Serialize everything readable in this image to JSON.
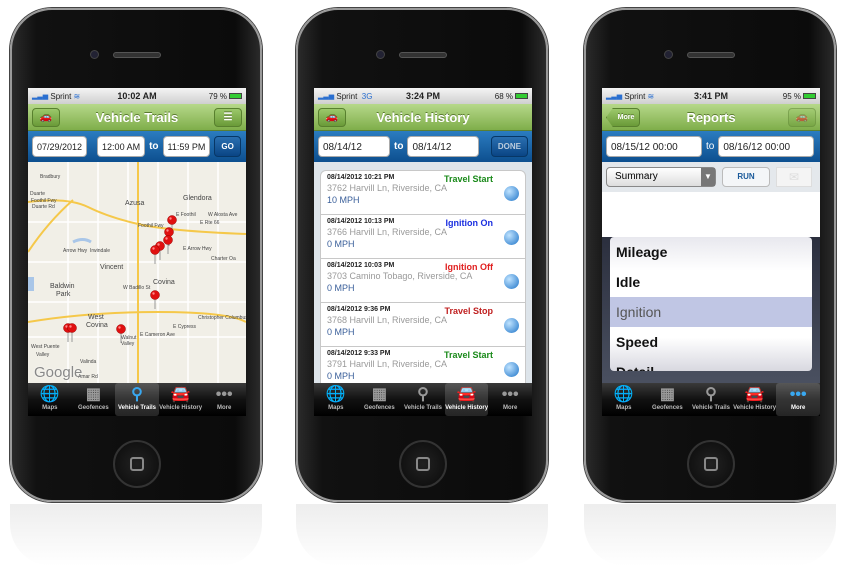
{
  "colors": {
    "nav_green": "#8dbb58",
    "date_blue": "#1a62a6",
    "travel_start": "#1a8a1a",
    "ignition_on": "#1a2ee0",
    "ignition_off": "#e02020",
    "travel_stop": "#c02020",
    "speed_text": "#3a5f9a"
  },
  "tabs": [
    {
      "label": "Maps",
      "icon": "globe-icon"
    },
    {
      "label": "Geofences",
      "icon": "grid-icon"
    },
    {
      "label": "Vehicle Trails",
      "icon": "joystick-pin-icon"
    },
    {
      "label": "Vehicle History",
      "icon": "car-clock-icon"
    },
    {
      "label": "More",
      "icon": "more-dots-icon"
    }
  ],
  "phone1": {
    "status": {
      "carrier": "Sprint",
      "time": "10:02 AM",
      "battery": "79 %"
    },
    "title": "Vehicle Trails",
    "active_tab": 2,
    "date": "07/29/2012",
    "from_time": "12:00 AM",
    "to": "to",
    "to_time": "11:59 PM",
    "go": "GO",
    "map_labels": [
      "Bradbury",
      "Duarte",
      "Foothil Fwy",
      "Duarte Rd",
      "Azusa",
      "Glendora",
      "E Foothil",
      "W Alosta Ave",
      "E Rte 66",
      "Foothil Fwy",
      "E Arrow Hwy",
      "Arrow Hwy",
      "Irwindale",
      "Charter Oa",
      "Vincent",
      "Baldwin",
      "Park",
      "Covina",
      "W Badillo St",
      "West",
      "Covina",
      "E Cypress",
      "E Cameron Ave",
      "Walnut",
      "Valley",
      "West Puente",
      "Valley",
      "Valinda",
      "Amar Rd",
      "Christopher Columbus Tr"
    ],
    "map_attribution": "Google"
  },
  "phone2": {
    "status": {
      "carrier": "Sprint",
      "network": "3G",
      "time": "3:24 PM",
      "battery": "68 %"
    },
    "title": "Vehicle History",
    "active_tab": 3,
    "from_date": "08/14/12",
    "to": "to",
    "to_date": "08/14/12",
    "done": "DONE",
    "events": [
      {
        "datetime": "08/14/2012 10:21 PM",
        "event": "Travel Start",
        "address": "3762 Harvill Ln, Riverside, CA",
        "speed": "10 MPH",
        "color": "#1a8a1a"
      },
      {
        "datetime": "08/14/2012 10:13 PM",
        "event": "Ignition On",
        "address": "3766 Harvill Ln, Riverside, CA",
        "speed": "0 MPH",
        "color": "#1a2ee0"
      },
      {
        "datetime": "08/14/2012 10:03 PM",
        "event": "Ignition Off",
        "address": "3703 Camino Tobago, Riverside, CA",
        "speed": "0 MPH",
        "color": "#e02020"
      },
      {
        "datetime": "08/14/2012 9:36 PM",
        "event": "Travel Stop",
        "address": "3768 Harvill Ln, Riverside, CA",
        "speed": "0 MPH",
        "color": "#c02020"
      },
      {
        "datetime": "08/14/2012 9:33 PM",
        "event": "Travel Start",
        "address": "3791 Harvill Ln, Riverside, CA",
        "speed": "0 MPH",
        "color": "#1a8a1a"
      }
    ]
  },
  "phone3": {
    "status": {
      "carrier": "Sprint",
      "time": "3:41 PM",
      "battery": "95 %"
    },
    "title": "Reports",
    "back": "More",
    "active_tab": 4,
    "from": "08/15/12 00:00",
    "to": "to",
    "to_value": "08/16/12 00:00",
    "report_type": "Summary",
    "run": "RUN",
    "picker_options": [
      "Mileage",
      "Idle",
      "Ignition",
      "Speed",
      "Detail"
    ],
    "picker_selected": "Ignition"
  }
}
